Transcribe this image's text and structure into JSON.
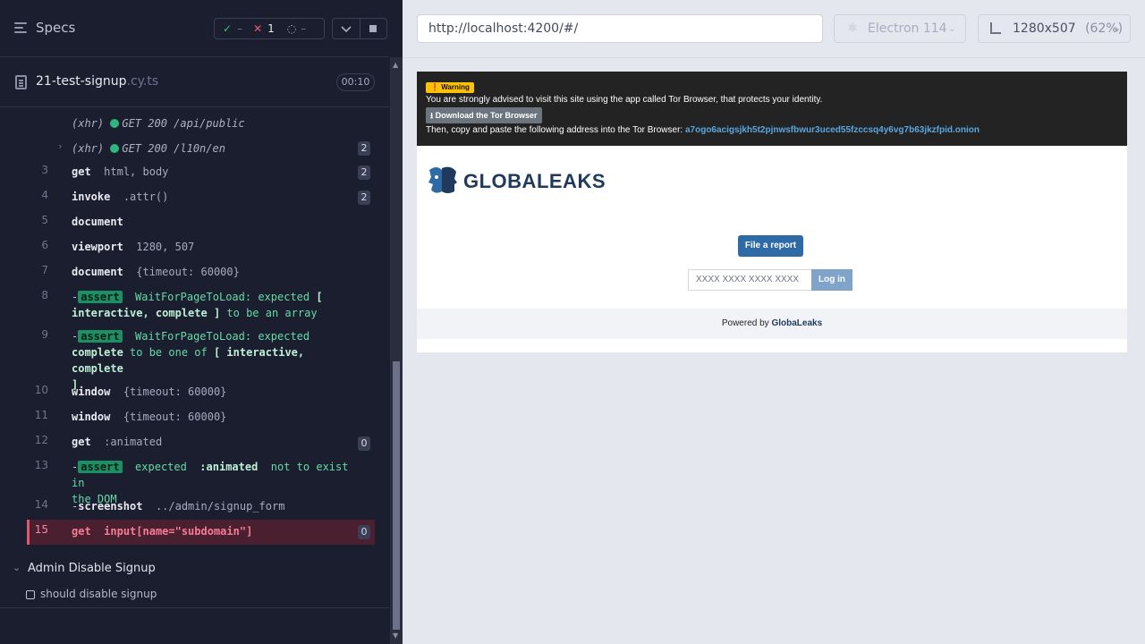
{
  "left": {
    "title": "Specs",
    "stats": {
      "passed": "–",
      "failed": "1",
      "pending": "–"
    },
    "file": {
      "name": "21-test-signup",
      "ext": ".cy.ts",
      "duration": "00:10"
    },
    "commands": [
      {
        "num": "",
        "kind": "xhr",
        "label": "(xhr)",
        "method": "GET 200 /api/public"
      },
      {
        "num": "",
        "kind": "xhr",
        "label": "(xhr)",
        "method": "GET 200 /l10n/en",
        "badge": "2"
      },
      {
        "num": "3",
        "name": "get",
        "arg": "html, body",
        "badge": "2"
      },
      {
        "num": "4",
        "name": "invoke",
        "arg": ".attr()",
        "badge": "2"
      },
      {
        "num": "5",
        "name": "document",
        "arg": ""
      },
      {
        "num": "6",
        "name": "viewport",
        "arg": "1280, 507"
      },
      {
        "num": "7",
        "name": "document",
        "arg": "{timeout: 60000}"
      },
      {
        "num": "8",
        "assert": "assert",
        "line1": "WaitForPageToLoad: expected",
        "line1b": "[",
        "line2a": "interactive, complete ]",
        "line2b": "to be an array"
      },
      {
        "num": "9",
        "assert": "assert",
        "line1": "WaitForPageToLoad: expected",
        "line2a": "complete",
        "line2b": "to be one of",
        "line2c": "[ interactive, complete",
        "line3": "]"
      },
      {
        "num": "10",
        "name": "window",
        "arg": "{timeout: 60000}"
      },
      {
        "num": "11",
        "name": "window",
        "arg": "{timeout: 60000}"
      },
      {
        "num": "12",
        "name": "get",
        "arg": ":animated",
        "badge": "0"
      },
      {
        "num": "13",
        "assert": "assert",
        "line1": "expected",
        "line1b": ":animated",
        "line1c": "not to exist in",
        "line2a": "the DOM"
      },
      {
        "num": "14",
        "name": "screenshot",
        "arg": "../admin/signup_form"
      },
      {
        "num": "15",
        "name": "get",
        "arg": "input[name=\"subdomain\"]",
        "badge": "0"
      }
    ],
    "suite": {
      "title": "Admin Disable Signup",
      "test": "should disable signup"
    }
  },
  "browser": {
    "url": "http://localhost:4200/#/",
    "engine": "Electron 114",
    "viewport": "1280x507",
    "zoom": "(62%)"
  },
  "app": {
    "warning_label": "Warning",
    "tor_advice": "You are strongly advised to visit this site using the app called Tor Browser, that protects your identity.",
    "tor_button": "Download the Tor Browser",
    "tor_copy": "Then, copy and paste the following address into the Tor Browser:",
    "onion": "a7ogo6acigsjkh5t2pjnwsfbwur3uced55fzccsq4y6vg7b63jkzfpid.onion",
    "logo_text": "GLOBALEAKS",
    "file_report": "File a report",
    "receipt_placeholder": "XXXX XXXX XXXX XXXX",
    "login": "Log in",
    "powered_by": "Powered by",
    "powered_name": "GlobaLeaks"
  }
}
